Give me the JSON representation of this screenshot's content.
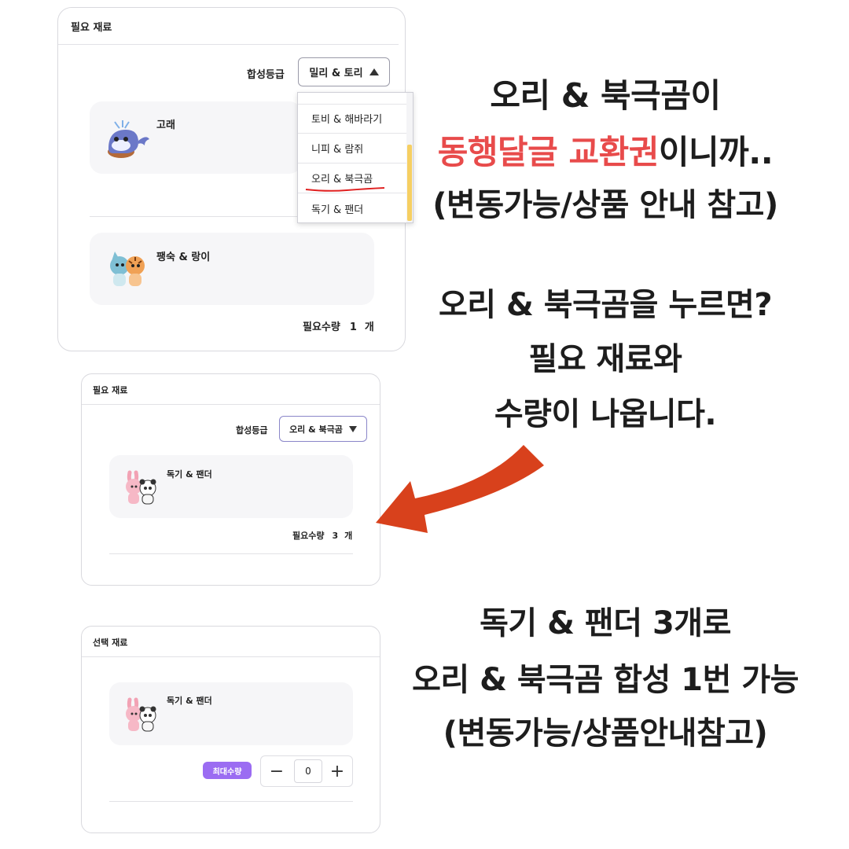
{
  "card1": {
    "title": "필요 재료",
    "grade_label": "합성등급",
    "grade_selected": "밀리 & 토리",
    "dropdown_options": [
      "토비 & 해바라기",
      "니피 & 람쥐",
      "오리 & 북극곰",
      "독기 & 팬더"
    ],
    "items": [
      {
        "name": "고래",
        "icon": "whale-icon"
      },
      {
        "name": "팽숙 & 랑이",
        "icon": "shark-tiger-icon"
      }
    ],
    "qty_label": "필요수량",
    "qty_value": "1",
    "qty_unit": "개"
  },
  "card2": {
    "title": "필요 재료",
    "grade_label": "합성등급",
    "grade_selected": "오리 & 북극곰",
    "item_name": "독기 & 팬더",
    "item_icon": "rabbit-panda-icon",
    "qty_label": "필요수량",
    "qty_value": "3",
    "qty_unit": "개"
  },
  "card3": {
    "title": "선택 재료",
    "item_name": "독기 & 팬더",
    "item_icon": "rabbit-panda-icon",
    "max_label": "최대수량",
    "stepper_value": "0",
    "minus": "−",
    "plus": "+"
  },
  "annotations": {
    "a1_line1": "오리 & 북극곰이",
    "a1_line2_red": "동행달글 교환권",
    "a1_line2_rest": "이니까..",
    "a1_line3": "(변동가능/상품 안내 참고)",
    "a2_line1": "오리 & 북극곰을 누르면?",
    "a2_line2": "필요 재료와",
    "a2_line3": "수량이 나옵니다.",
    "a3_line1": "독기 & 팬더 3개로",
    "a3_line2": "오리 & 북극곰 합성 1번 가능",
    "a3_line3": "(변동가능/상품안내참고)"
  },
  "colors": {
    "accent_red": "#e84b4b",
    "arrow": "#d8411c",
    "badge_purple": "#9b6cf2",
    "scroll_thumb": "#f6cf62",
    "underline": "#e02020"
  }
}
